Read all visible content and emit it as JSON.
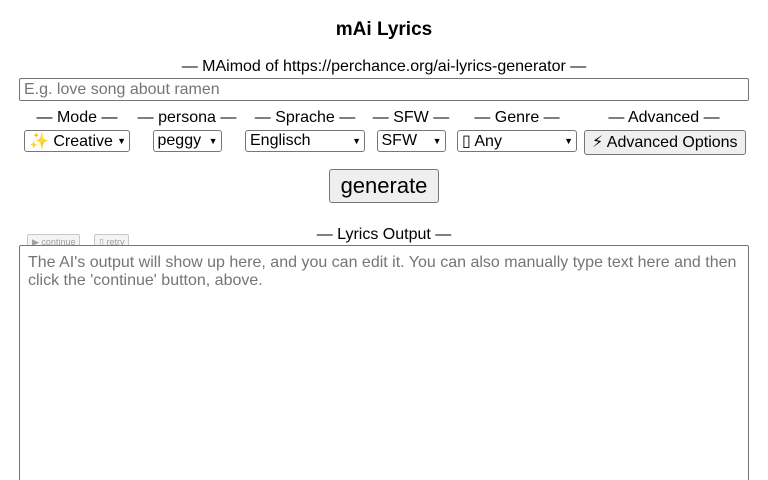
{
  "app": {
    "title": "mAi Lyrics",
    "subtitle": "— MAimod of https://perchance.org/ai-lyrics-generator —"
  },
  "prompt": {
    "placeholder": "E.g. love song about ramen",
    "value": ""
  },
  "controls": {
    "mode": {
      "label": "— Mode —",
      "value": "✨ Creative",
      "icon": "sparkle-icon"
    },
    "persona": {
      "label": "— persona —",
      "value": "peggy"
    },
    "language": {
      "label": "— Sprache —",
      "value": "Englisch"
    },
    "sfw": {
      "label": "— SFW —",
      "value": "SFW"
    },
    "genre": {
      "label": "— Genre —",
      "value": "▯ Any"
    },
    "advanced": {
      "label": "— Advanced —",
      "button_label": "⚡ Advanced Options",
      "icon": "lightning-icon"
    }
  },
  "generate_label": "generate",
  "output": {
    "label": "— Lyrics Output —",
    "continue_label": "▶ continue",
    "retry_label": "▯ retry",
    "placeholder": "The AI's output will show up here, and you can edit it. You can also manually type text here and then click the 'continue' button, above.",
    "value": ""
  }
}
